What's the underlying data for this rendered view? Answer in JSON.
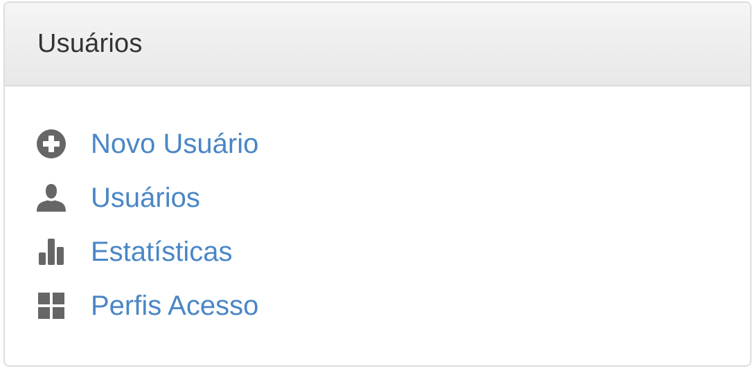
{
  "panel": {
    "title": "Usuários"
  },
  "menu": {
    "items": [
      {
        "label": "Novo Usuário",
        "icon": "plus-circle-icon"
      },
      {
        "label": "Usuários",
        "icon": "user-icon"
      },
      {
        "label": "Estatísticas",
        "icon": "stats-icon"
      },
      {
        "label": "Perfis Acesso",
        "icon": "grid-icon"
      }
    ]
  },
  "colors": {
    "link": "#4a86c6",
    "icon": "#666666",
    "title": "#333333",
    "border": "#dddddd"
  }
}
